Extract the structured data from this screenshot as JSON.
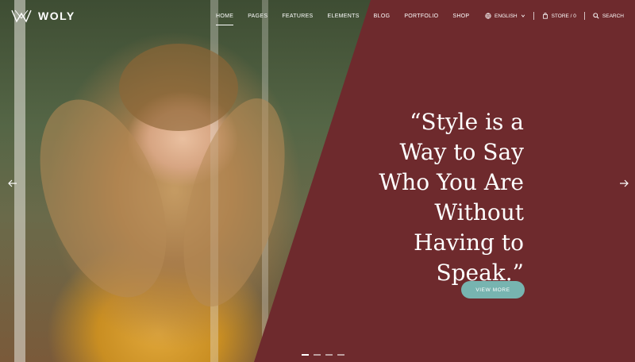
{
  "brand": {
    "name": "WOLY"
  },
  "nav": {
    "items": [
      {
        "label": "HOME",
        "active": true
      },
      {
        "label": "PAGES"
      },
      {
        "label": "FEATURES"
      },
      {
        "label": "ELEMENTS"
      },
      {
        "label": "BLOG"
      },
      {
        "label": "PORTFOLIO"
      },
      {
        "label": "SHOP"
      }
    ]
  },
  "utility": {
    "language": "ENGLISH",
    "store": "STORE / 0",
    "search": "SEARCH"
  },
  "hero": {
    "quote_lines": [
      "“Style is a",
      "Way to Say",
      "Who You Are",
      "Without",
      "Having to",
      "Speak.”"
    ],
    "cta_label": "VIEW MORE",
    "slide_count": 4
  },
  "colors": {
    "panel": "#6e2a2d",
    "accent": "#77b4b0"
  },
  "icons": {
    "prev": "arrow-left-icon",
    "next": "arrow-right-icon",
    "language": "globe-icon",
    "store": "bag-icon",
    "search": "search-icon"
  }
}
